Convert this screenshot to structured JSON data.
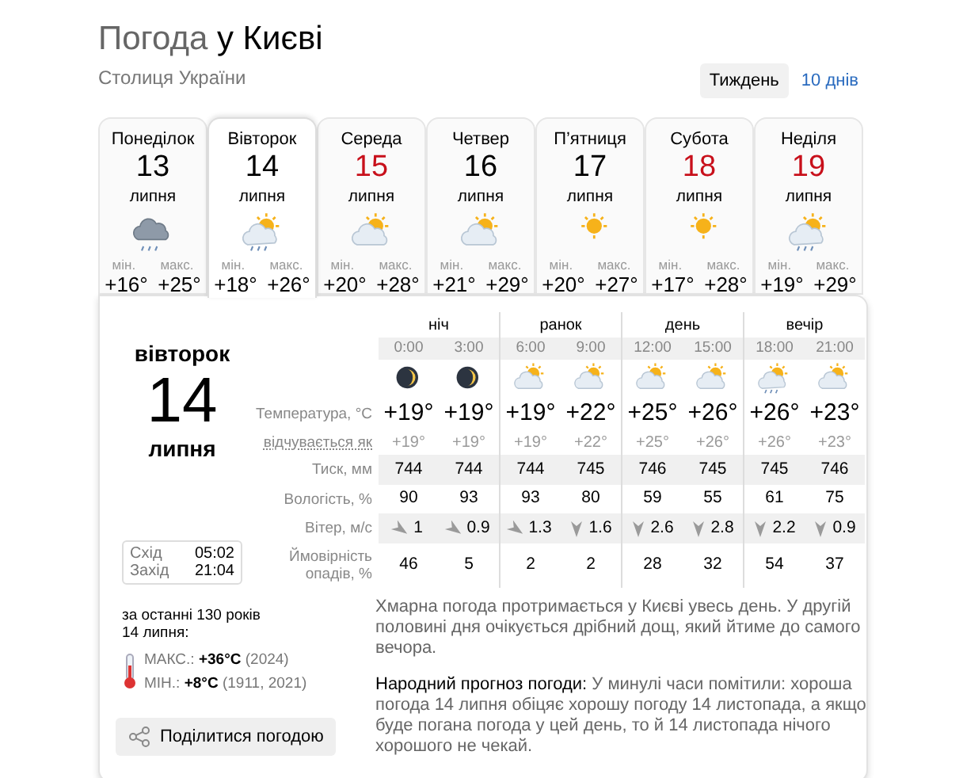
{
  "header": {
    "title_prefix": "Погода",
    "title_city": "у Києві",
    "subtitle": "Столиця України"
  },
  "range_tabs": [
    {
      "label": "Тиждень",
      "selected": true
    },
    {
      "label": "10 днів",
      "selected": false
    }
  ],
  "days": [
    {
      "weekday": "Понеділок",
      "day": "13",
      "month": "липня",
      "kind": "storm",
      "min_label": "мін.",
      "max_label": "макс.",
      "min": "+16°",
      "max": "+25°",
      "selected": false,
      "holiday": false
    },
    {
      "weekday": "Вівторок",
      "day": "14",
      "month": "липня",
      "kind": "showers",
      "min_label": "мін.",
      "max_label": "макс.",
      "min": "+18°",
      "max": "+26°",
      "selected": true,
      "holiday": false
    },
    {
      "weekday": "Середа",
      "day": "15",
      "month": "липня",
      "kind": "cloudy",
      "min_label": "мін.",
      "max_label": "макс.",
      "min": "+20°",
      "max": "+28°",
      "selected": false,
      "holiday": true
    },
    {
      "weekday": "Четвер",
      "day": "16",
      "month": "липня",
      "kind": "cloudy",
      "min_label": "мін.",
      "max_label": "макс.",
      "min": "+21°",
      "max": "+29°",
      "selected": false,
      "holiday": false
    },
    {
      "weekday": "П’ятниця",
      "day": "17",
      "month": "липня",
      "kind": "clear",
      "min_label": "мін.",
      "max_label": "макс.",
      "min": "+20°",
      "max": "+27°",
      "selected": false,
      "holiday": false
    },
    {
      "weekday": "Субота",
      "day": "18",
      "month": "липня",
      "kind": "clear",
      "min_label": "мін.",
      "max_label": "макс.",
      "min": "+17°",
      "max": "+28°",
      "selected": false,
      "holiday": true
    },
    {
      "weekday": "Неділя",
      "day": "19",
      "month": "липня",
      "kind": "showers",
      "min_label": "мін.",
      "max_label": "макс.",
      "min": "+19°",
      "max": "+29°",
      "selected": false,
      "holiday": true
    }
  ],
  "detail": {
    "weekday": "вівторок",
    "day": "14",
    "month": "липня",
    "sun": {
      "rise_label": "Схід",
      "rise": "05:02",
      "set_label": "Захід",
      "set": "21:04"
    },
    "history": {
      "line_1": "за останні 130 років",
      "line_2": "14 липня:",
      "max": "МАКС.: **+36°C** (2024)",
      "min": "МІН.: **+8°C** (1911, 2021)"
    },
    "share_button": "Поділитися погодою",
    "periods": [
      "ніч",
      "ранок",
      "день",
      "вечір"
    ],
    "row_labels": {
      "temperature": "Температура, °C",
      "feels_like": "відчувається як",
      "pressure": "Тиск, мм",
      "humidity": "Вологість, %",
      "wind": "Вітер, м/с",
      "precipitation": "Ймовірність опадів, %"
    },
    "hours": [
      {
        "time": "0:00",
        "kind": "night",
        "temperature": "+19°",
        "feels_like": "+19°",
        "pressure": "744",
        "humidity": "90",
        "wind": {
          "kind": "diagonal",
          "speed": "1"
        },
        "precipitation": "46"
      },
      {
        "time": "3:00",
        "kind": "night",
        "temperature": "+19°",
        "feels_like": "+19°",
        "pressure": "744",
        "humidity": "93",
        "wind": {
          "kind": "diagonal",
          "speed": "0.9"
        },
        "precipitation": "5"
      },
      {
        "time": "6:00",
        "kind": "cloudy",
        "temperature": "+19°",
        "feels_like": "+19°",
        "pressure": "744",
        "humidity": "93",
        "wind": {
          "kind": "diagonal",
          "speed": "1.3"
        },
        "precipitation": "2"
      },
      {
        "time": "9:00",
        "kind": "cloudy",
        "temperature": "+22°",
        "feels_like": "+22°",
        "pressure": "745",
        "humidity": "80",
        "wind": {
          "kind": "vertical",
          "speed": "1.6"
        },
        "precipitation": "2"
      },
      {
        "time": "12:00",
        "kind": "cloudy",
        "temperature": "+25°",
        "feels_like": "+25°",
        "pressure": "746",
        "humidity": "59",
        "wind": {
          "kind": "vertical",
          "speed": "2.6"
        },
        "precipitation": "28"
      },
      {
        "time": "15:00",
        "kind": "cloudy",
        "temperature": "+26°",
        "feels_like": "+26°",
        "pressure": "745",
        "humidity": "55",
        "wind": {
          "kind": "vertical",
          "speed": "2.8"
        },
        "precipitation": "32"
      },
      {
        "time": "18:00",
        "kind": "showers",
        "temperature": "+26°",
        "feels_like": "+26°",
        "pressure": "745",
        "humidity": "61",
        "wind": {
          "kind": "vertical",
          "speed": "2.2"
        },
        "precipitation": "54"
      },
      {
        "time": "21:00",
        "kind": "cloudy",
        "temperature": "+23°",
        "feels_like": "+23°",
        "pressure": "746",
        "humidity": "75",
        "wind": {
          "kind": "vertical",
          "speed": "0.9"
        },
        "precipitation": "37"
      }
    ],
    "description": "Хмарна погода протримається у Києві увесь день. У другій половині дня очікується дрібний дощ, який йтиме до самого вечора.",
    "folk_forecast": "**Народний прогноз погоди:** У минулі часи помітили: хороша погода 14 липня обіцяє хорошу погоду 14 листопада, а якщо буде погана погода у цей день, то й 14 листопада нічого хорошого не чекай."
  }
}
